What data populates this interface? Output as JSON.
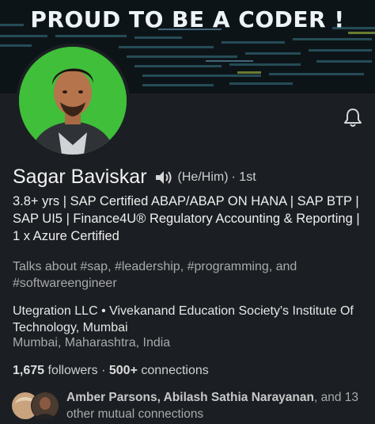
{
  "banner": {
    "title": "PROUD TO BE A CODER !"
  },
  "profile": {
    "name": "Sagar Baviskar",
    "pronouns": "(He/Him)",
    "degree": "· 1st",
    "headline": "3.8+ yrs | SAP Certified ABAP/ABAP ON HANA | SAP BTP | SAP UI5 | Finance4U® Regulatory Accounting & Reporting | 1 x Azure Certified",
    "talks_about": "Talks about #sap, #leadership, #programming, and #softwareengineer",
    "company": "Utegration LLC • Vivekanand Education Society's Institute Of Technology, Mumbai",
    "location": "Mumbai, Maharashtra, India"
  },
  "stats": {
    "followers": "1,675",
    "followers_label": "followers",
    "separator": "·",
    "connections": "500+",
    "connections_label": "connections"
  },
  "mutual": {
    "names": "Amber Parsons, Abilash Sathia Narayanan",
    "suffix": ", and 13 other mutual connections"
  },
  "colors": {
    "background": "#1b1f23",
    "avatar_bg": "#3fbf3a",
    "banner_bg": "#0d1418"
  },
  "icons": {
    "bell": "bell-icon",
    "speaker": "speaker-icon"
  }
}
